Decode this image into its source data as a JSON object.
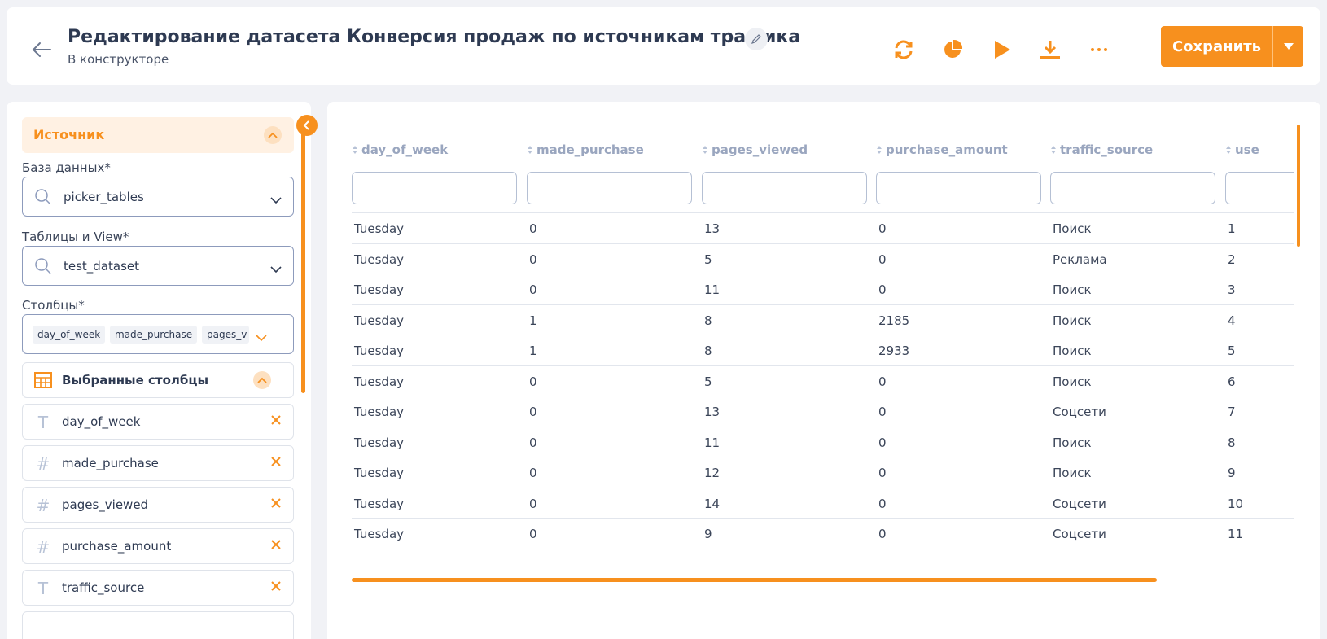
{
  "header": {
    "title": "Редактирование датасета Конверсия продаж по источникам трафика",
    "subtitle": "В конструкторе",
    "save_label": "Сохранить",
    "icons": [
      "back-arrow-icon",
      "edit-pencil-icon",
      "refresh-icon",
      "pie-chart-icon",
      "play-icon",
      "download-icon",
      "more-dots-icon",
      "caret-down-icon"
    ]
  },
  "sidebar": {
    "section_title": "Источник",
    "database_label": "База данных*",
    "database_value": "picker_tables",
    "tables_label": "Таблицы и View*",
    "tables_value": "test_dataset",
    "columns_label": "Столбцы*",
    "column_tags": [
      "day_of_week",
      "made_purchase",
      "pages_v"
    ],
    "selected_title": "Выбранные столбцы",
    "selected_columns": [
      {
        "type": "T",
        "name": "day_of_week"
      },
      {
        "type": "#",
        "name": "made_purchase"
      },
      {
        "type": "#",
        "name": "pages_viewed"
      },
      {
        "type": "#",
        "name": "purchase_amount"
      },
      {
        "type": "T",
        "name": "traffic_source"
      }
    ]
  },
  "table": {
    "columns": [
      "day_of_week",
      "made_purchase",
      "pages_viewed",
      "purchase_amount",
      "traffic_source",
      "use"
    ],
    "rows": [
      [
        "Tuesday",
        "0",
        "13",
        "0",
        "Поиск",
        "1"
      ],
      [
        "Tuesday",
        "0",
        "5",
        "0",
        "Реклама",
        "2"
      ],
      [
        "Tuesday",
        "0",
        "11",
        "0",
        "Поиск",
        "3"
      ],
      [
        "Tuesday",
        "1",
        "8",
        "2185",
        "Поиск",
        "4"
      ],
      [
        "Tuesday",
        "1",
        "8",
        "2933",
        "Поиск",
        "5"
      ],
      [
        "Tuesday",
        "0",
        "5",
        "0",
        "Поиск",
        "6"
      ],
      [
        "Tuesday",
        "0",
        "13",
        "0",
        "Соцсети",
        "7"
      ],
      [
        "Tuesday",
        "0",
        "11",
        "0",
        "Поиск",
        "8"
      ],
      [
        "Tuesday",
        "0",
        "12",
        "0",
        "Поиск",
        "9"
      ],
      [
        "Tuesday",
        "0",
        "14",
        "0",
        "Соцсети",
        "10"
      ],
      [
        "Tuesday",
        "0",
        "9",
        "0",
        "Соцсети",
        "11"
      ]
    ]
  },
  "colors": {
    "accent": "#f7901e",
    "text": "#2e3a52",
    "muted": "#9aa6bf"
  }
}
